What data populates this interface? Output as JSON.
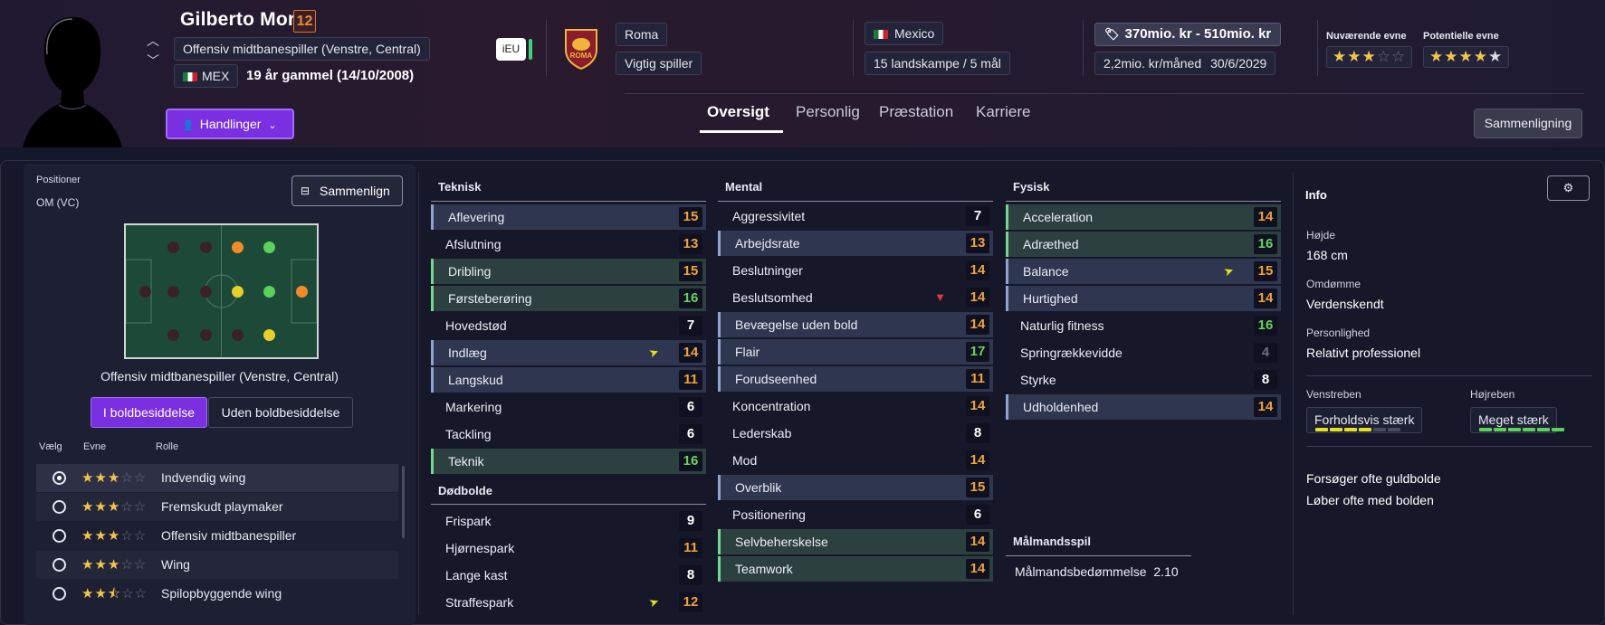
{
  "player": {
    "name": "Gilberto Mora",
    "number": "12",
    "position": "Offensiv midtbanespiller (Venstre, Central)",
    "nationality_code": "MEX",
    "age_text": "19 år gammel (14/10/2008)",
    "eu_badge": "iEU"
  },
  "club": {
    "name": "Roma",
    "status": "Vigtig spiller"
  },
  "nation": {
    "name": "Mexico",
    "caps": "15 landskampe / 5 mål"
  },
  "value": {
    "price": "370mio. kr - 510mio. kr",
    "wage": "2,2mio. kr/måned",
    "contract_end": "30/6/2029"
  },
  "ability": {
    "current_label": "Nuværende evne",
    "current_stars": 3,
    "potential_label": "Potentielle evne",
    "potential_stars": 4.5
  },
  "actions": {
    "label": "Handlinger"
  },
  "tabs": [
    "Oversigt",
    "Personlig",
    "Præstation",
    "Karriere"
  ],
  "compare_top": "Sammenligning",
  "positions": {
    "title": "Positioner",
    "value": "OM (VC)",
    "compare_btn": "Sammenlign",
    "role_text": "Offensiv midtbanespiller (Venstre, Central)",
    "toggle_on": "I boldbesiddelse",
    "toggle_off": "Uden boldbesiddelse",
    "headers": {
      "select": "Vælg",
      "ability": "Evne",
      "role": "Rolle"
    },
    "roles": [
      {
        "name": "Indvendig wing",
        "stars": 3,
        "selected": true
      },
      {
        "name": "Fremskudt playmaker",
        "stars": 3,
        "selected": false
      },
      {
        "name": "Offensiv midtbanespiller",
        "stars": 3,
        "selected": false
      },
      {
        "name": "Wing",
        "stars": 3,
        "selected": false
      },
      {
        "name": "Spilopbyggende wing",
        "stars": 2.5,
        "selected": false
      }
    ]
  },
  "attributes": {
    "technical_title": "Teknisk",
    "technical": [
      {
        "name": "Aflevering",
        "value": 15,
        "color": "orange",
        "hl": "blue"
      },
      {
        "name": "Afslutning",
        "value": 13,
        "color": "orange",
        "hl": "none"
      },
      {
        "name": "Dribling",
        "value": 15,
        "color": "orange",
        "hl": "green"
      },
      {
        "name": "Førsteberøring",
        "value": 16,
        "color": "green",
        "hl": "green"
      },
      {
        "name": "Hovedstød",
        "value": 7,
        "color": "white",
        "hl": "none"
      },
      {
        "name": "Indlæg",
        "value": 14,
        "color": "orange",
        "hl": "blue",
        "trend": "up"
      },
      {
        "name": "Langskud",
        "value": 11,
        "color": "orange",
        "hl": "blue"
      },
      {
        "name": "Markering",
        "value": 6,
        "color": "white",
        "hl": "none"
      },
      {
        "name": "Tackling",
        "value": 6,
        "color": "white",
        "hl": "none"
      },
      {
        "name": "Teknik",
        "value": 16,
        "color": "green",
        "hl": "green"
      }
    ],
    "setpieces_title": "Dødbolde",
    "setpieces": [
      {
        "name": "Frispark",
        "value": 9,
        "color": "white",
        "hl": "none"
      },
      {
        "name": "Hjørnespark",
        "value": 11,
        "color": "orange",
        "hl": "none"
      },
      {
        "name": "Lange kast",
        "value": 8,
        "color": "white",
        "hl": "none"
      },
      {
        "name": "Straffespark",
        "value": 12,
        "color": "orange",
        "hl": "none",
        "trend": "up"
      }
    ],
    "mental_title": "Mental",
    "mental": [
      {
        "name": "Aggressivitet",
        "value": 7,
        "color": "white",
        "hl": "none"
      },
      {
        "name": "Arbejdsrate",
        "value": 13,
        "color": "orange",
        "hl": "blue"
      },
      {
        "name": "Beslutninger",
        "value": 14,
        "color": "orange",
        "hl": "none"
      },
      {
        "name": "Beslutsomhed",
        "value": 14,
        "color": "orange",
        "hl": "none",
        "trend": "down"
      },
      {
        "name": "Bevægelse uden bold",
        "value": 14,
        "color": "orange",
        "hl": "blue"
      },
      {
        "name": "Flair",
        "value": 17,
        "color": "green",
        "hl": "blue"
      },
      {
        "name": "Forudseenhed",
        "value": 11,
        "color": "orange",
        "hl": "blue"
      },
      {
        "name": "Koncentration",
        "value": 14,
        "color": "orange",
        "hl": "none"
      },
      {
        "name": "Lederskab",
        "value": 8,
        "color": "white",
        "hl": "none"
      },
      {
        "name": "Mod",
        "value": 14,
        "color": "orange",
        "hl": "none"
      },
      {
        "name": "Overblik",
        "value": 15,
        "color": "orange",
        "hl": "blue"
      },
      {
        "name": "Positionering",
        "value": 6,
        "color": "white",
        "hl": "none"
      },
      {
        "name": "Selvbeherskelse",
        "value": 14,
        "color": "orange",
        "hl": "green"
      },
      {
        "name": "Teamwork",
        "value": 14,
        "color": "orange",
        "hl": "green"
      }
    ],
    "physical_title": "Fysisk",
    "physical": [
      {
        "name": "Acceleration",
        "value": 14,
        "color": "orange",
        "hl": "green"
      },
      {
        "name": "Adræthed",
        "value": 16,
        "color": "green",
        "hl": "green"
      },
      {
        "name": "Balance",
        "value": 15,
        "color": "orange",
        "hl": "blue",
        "trend": "up"
      },
      {
        "name": "Hurtighed",
        "value": 14,
        "color": "orange",
        "hl": "blue"
      },
      {
        "name": "Naturlig fitness",
        "value": 16,
        "color": "green",
        "hl": "none"
      },
      {
        "name": "Springrækkevidde",
        "value": 4,
        "color": "grey",
        "hl": "none"
      },
      {
        "name": "Styrke",
        "value": 8,
        "color": "white",
        "hl": "none"
      },
      {
        "name": "Udholdenhed",
        "value": 14,
        "color": "orange",
        "hl": "blue"
      }
    ],
    "gk_title": "Målmandsspil",
    "gk_rating_label": "Målmandsbedømmelse",
    "gk_rating_value": "2.10"
  },
  "info": {
    "title": "Info",
    "height_label": "Højde",
    "height": "168 cm",
    "reputation_label": "Omdømme",
    "reputation": "Verdenskendt",
    "personality_label": "Personlighed",
    "personality": "Relativt professionel",
    "left_foot_label": "Venstreben",
    "left_foot": "Forholdsvis stærk",
    "left_foot_level": 4,
    "right_foot_label": "Højreben",
    "right_foot": "Meget stærk",
    "right_foot_level": 6,
    "traits": [
      "Forsøger ofte guldbolde",
      "Løber ofte med bolden"
    ]
  },
  "colors": {
    "accent": "#7a2fe0",
    "orange": "#f0a23a",
    "green": "#6ad35c",
    "yellow": "#e3e21c"
  }
}
